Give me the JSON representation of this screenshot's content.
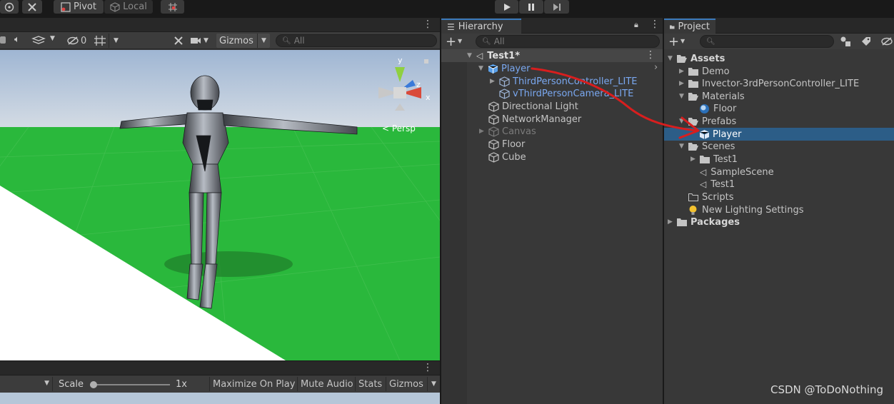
{
  "toolbar": {
    "pivot_label": "Pivot",
    "local_label": "Local"
  },
  "scene_view": {
    "toolbar_count": "0",
    "gizmos_label": "Gizmos",
    "search_placeholder": "All",
    "persp_label": "< Persp",
    "axis_y": "y",
    "axis_z": "z",
    "axis_x": "x"
  },
  "game_view": {
    "scale_label": "Scale",
    "scale_value": "1x",
    "maximize_label": "Maximize On Play",
    "mute_label": "Mute Audio",
    "stats_label": "Stats",
    "gizmos_label": "Gizmos"
  },
  "hierarchy": {
    "tab_label": "Hierarchy",
    "search_placeholder": "All",
    "scene_name": "Test1*",
    "items": [
      {
        "label": "Player"
      },
      {
        "label": "ThirdPersonController_LITE"
      },
      {
        "label": "vThirdPersonCamera_LITE"
      },
      {
        "label": "Directional Light"
      },
      {
        "label": "NetworkManager"
      },
      {
        "label": "Canvas"
      },
      {
        "label": "Floor"
      },
      {
        "label": "Cube"
      }
    ]
  },
  "project": {
    "tab_label": "Project",
    "items": [
      {
        "label": "Assets"
      },
      {
        "label": "Demo"
      },
      {
        "label": "Invector-3rdPersonController_LITE"
      },
      {
        "label": "Materials"
      },
      {
        "label": "Floor"
      },
      {
        "label": "Prefabs"
      },
      {
        "label": "Player"
      },
      {
        "label": "Scenes"
      },
      {
        "label": "Test1"
      },
      {
        "label": "SampleScene"
      },
      {
        "label": "Test1"
      },
      {
        "label": "Scripts"
      },
      {
        "label": "New Lighting Settings"
      },
      {
        "label": "Packages"
      }
    ]
  },
  "watermark": "CSDN @ToDoNothing",
  "colors": {
    "selection": "#2c5d87",
    "prefab_blue": "#7aa8f0",
    "ground_green": "#2ab83c",
    "sky": "#c8d4e2",
    "annotation_red": "#d81e1e"
  }
}
